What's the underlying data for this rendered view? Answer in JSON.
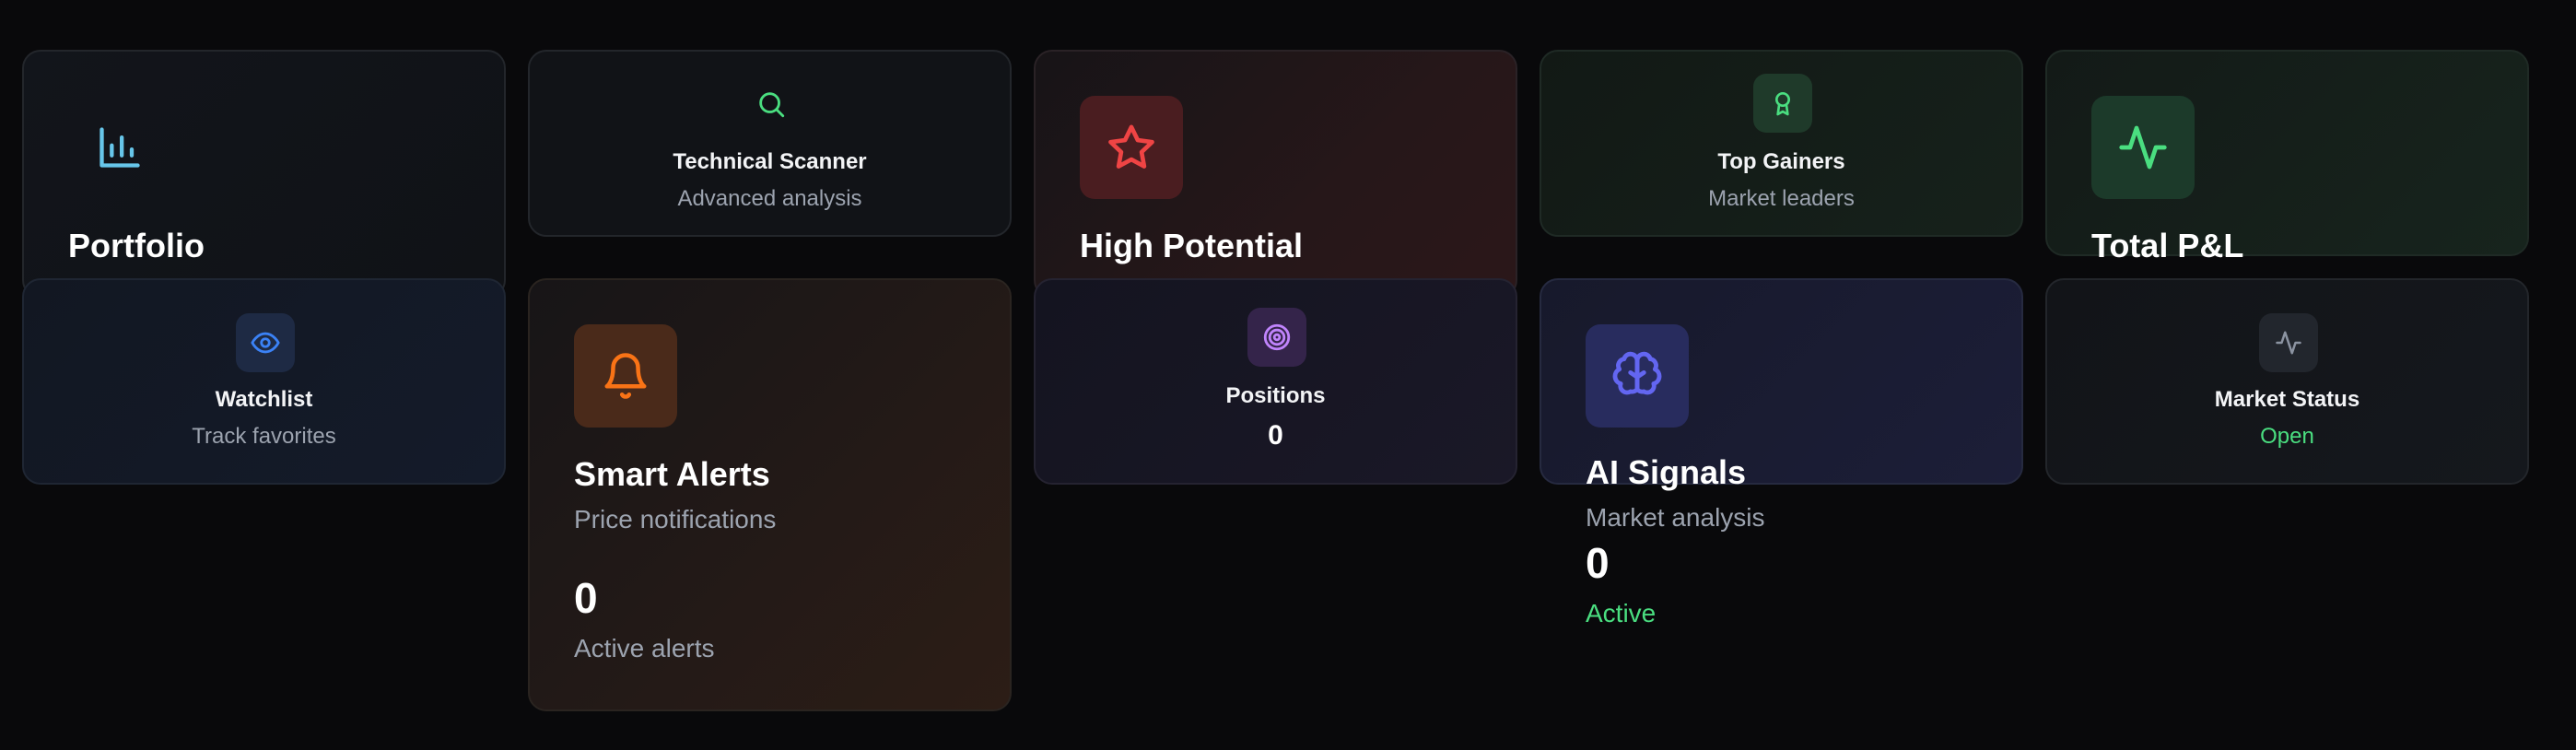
{
  "cards": {
    "portfolio": {
      "title": "Portfolio",
      "icon": "bar-chart-icon"
    },
    "technical_scanner": {
      "title": "Technical Scanner",
      "subtitle": "Advanced analysis",
      "icon": "search-icon"
    },
    "high_potential": {
      "title": "High Potential",
      "icon": "star-icon"
    },
    "top_gainers": {
      "title": "Top Gainers",
      "subtitle": "Market leaders",
      "icon": "award-icon"
    },
    "total_pnl": {
      "title": "Total P&L",
      "icon": "activity-icon"
    },
    "watchlist": {
      "title": "Watchlist",
      "subtitle": "Track favorites",
      "icon": "eye-icon"
    },
    "smart_alerts": {
      "title": "Smart Alerts",
      "subtitle": "Price notifications",
      "count": "0",
      "count_label": "Active alerts",
      "icon": "bell-icon"
    },
    "positions": {
      "title": "Positions",
      "count": "0",
      "icon": "target-icon"
    },
    "ai_signals": {
      "title": "AI Signals",
      "subtitle": "Market analysis",
      "count": "0",
      "status": "Active",
      "icon": "brain-icon"
    },
    "market_status": {
      "title": "Market Status",
      "status": "Open",
      "icon": "activity-icon"
    }
  },
  "colors": {
    "background": "#09090b",
    "positive_green": "#4ade80",
    "cyan": "#67c6ea",
    "red": "#ef4444",
    "orange": "#f97316",
    "purple": "#c084fc",
    "indigo": "#6366f1",
    "blue": "#3b82f6"
  }
}
